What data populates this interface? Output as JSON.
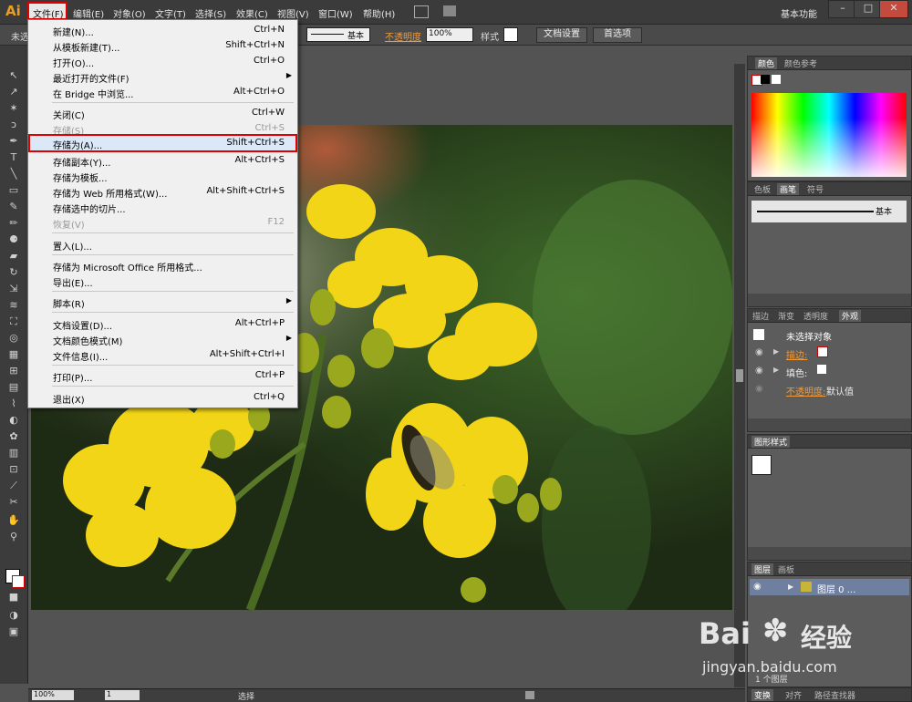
{
  "app": {
    "logo": "Ai",
    "workspace": "基本功能"
  },
  "menubar": {
    "items": [
      "文件(F)",
      "编辑(E)",
      "对象(O)",
      "文字(T)",
      "选择(S)",
      "效果(C)",
      "视图(V)",
      "窗口(W)",
      "帮助(H)"
    ]
  },
  "controlbar": {
    "left_label": "未选",
    "stroke_label": "基本",
    "opacity_label": "不透明度",
    "opacity_value": "100%",
    "style_label": "样式",
    "doc_setup": "文档设置",
    "preferences": "首选项"
  },
  "file_menu": {
    "items": [
      {
        "label": "新建(N)...",
        "shortcut": "Ctrl+N"
      },
      {
        "label": "从模板新建(T)...",
        "shortcut": "Shift+Ctrl+N"
      },
      {
        "label": "打开(O)...",
        "shortcut": "Ctrl+O"
      },
      {
        "label": "最近打开的文件(F)",
        "shortcut": ""
      },
      {
        "label": "在 Bridge 中浏览...",
        "shortcut": "Alt+Ctrl+O"
      },
      {
        "label": "关闭(C)",
        "shortcut": "Ctrl+W"
      },
      {
        "label": "存储(S)",
        "shortcut": "Ctrl+S"
      },
      {
        "label": "存储为(A)...",
        "shortcut": "Shift+Ctrl+S"
      },
      {
        "label": "存储副本(Y)...",
        "shortcut": "Alt+Ctrl+S"
      },
      {
        "label": "存储为模板...",
        "shortcut": ""
      },
      {
        "label": "存储为 Web 所用格式(W)...",
        "shortcut": "Alt+Shift+Ctrl+S"
      },
      {
        "label": "存储选中的切片...",
        "shortcut": ""
      },
      {
        "label": "恢复(V)",
        "shortcut": "F12"
      },
      {
        "label": "置入(L)...",
        "shortcut": ""
      },
      {
        "label": "存储为 Microsoft Office 所用格式...",
        "shortcut": ""
      },
      {
        "label": "导出(E)...",
        "shortcut": ""
      },
      {
        "label": "脚本(R)",
        "shortcut": ""
      },
      {
        "label": "文档设置(D)...",
        "shortcut": "Alt+Ctrl+P"
      },
      {
        "label": "文档颜色模式(M)",
        "shortcut": ""
      },
      {
        "label": "文件信息(I)...",
        "shortcut": "Alt+Shift+Ctrl+I"
      },
      {
        "label": "打印(P)...",
        "shortcut": "Ctrl+P"
      },
      {
        "label": "退出(X)",
        "shortcut": "Ctrl+Q"
      }
    ]
  },
  "panels": {
    "color": {
      "tabs": [
        "颜色",
        "颜色参考"
      ]
    },
    "brushes": {
      "tabs": [
        "色板",
        "画笔",
        "符号"
      ],
      "brush_name": "基本"
    },
    "appearance": {
      "tabs": [
        "描边",
        "渐变",
        "透明度",
        "外观"
      ],
      "title": "未选择对象",
      "stroke_label": "描边:",
      "fill_label": "填色:",
      "opacity_label": "不透明度:",
      "opacity_value": "默认值"
    },
    "graphic_styles": {
      "tabs": [
        "图形样式"
      ]
    },
    "layers": {
      "tabs": [
        "图层",
        "画板"
      ],
      "layer_name": "图层 0 ...",
      "footer": "1 个图层"
    },
    "bottom": {
      "tabs": [
        "变换",
        "对齐",
        "路径查找器"
      ]
    }
  },
  "statusbar": {
    "zoom": "100%",
    "page": "1",
    "tool": "选择"
  },
  "watermark": {
    "brand": "Bai",
    "brand2": "经验",
    "url": "jingyan.baidu.com"
  },
  "colors": {
    "highlight_border": "#e10000",
    "ai_orange": "#e8a024"
  }
}
